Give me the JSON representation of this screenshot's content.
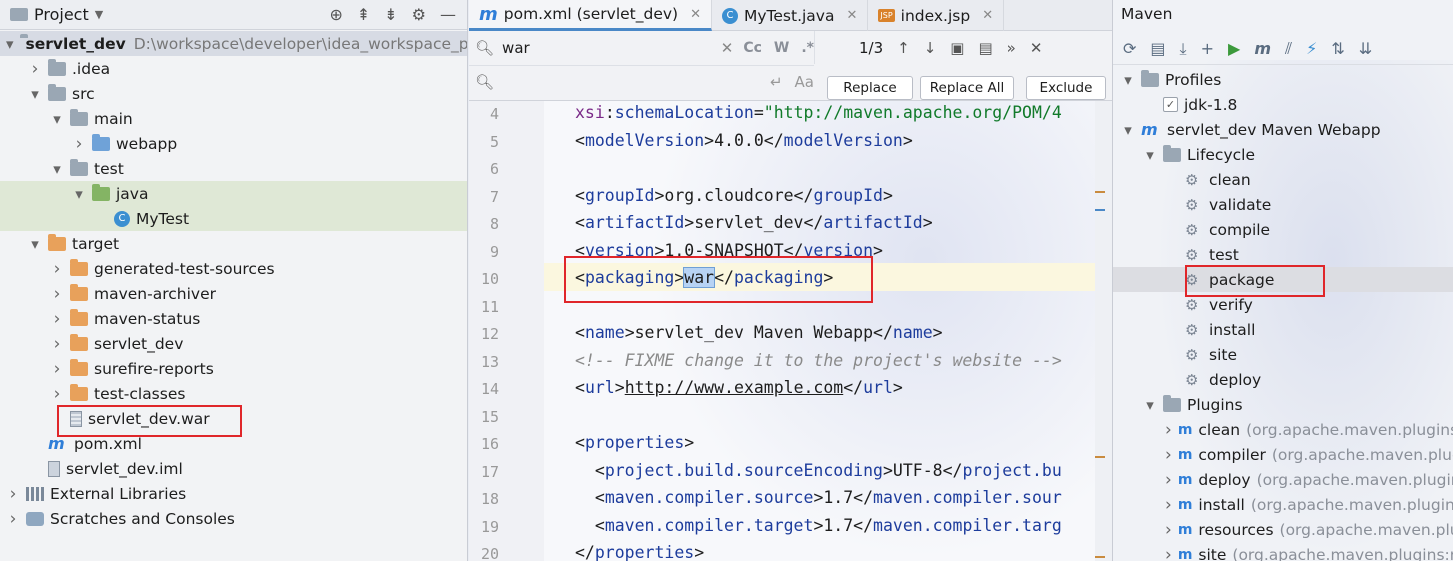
{
  "project": {
    "title": "Project",
    "header_icons": [
      "target-icon",
      "collapse-all-icon",
      "expand-all-icon",
      "gear-icon",
      "minimize-icon"
    ],
    "tree": [
      {
        "label": "servlet_dev",
        "path": "D:\\workspace\\developer\\idea_workspace_p",
        "depth": 0,
        "arrow": "v",
        "icon": "module-folder",
        "bold": true
      },
      {
        "label": ".idea",
        "depth": 1,
        "arrow": ">",
        "icon": "folder"
      },
      {
        "label": "src",
        "depth": 1,
        "arrow": "v",
        "icon": "folder"
      },
      {
        "label": "main",
        "depth": 2,
        "arrow": "v",
        "icon": "folder"
      },
      {
        "label": "webapp",
        "depth": 3,
        "arrow": ">",
        "icon": "folder-blue"
      },
      {
        "label": "test",
        "depth": 2,
        "arrow": "v",
        "icon": "folder"
      },
      {
        "label": "java",
        "depth": 3,
        "arrow": "v",
        "icon": "folder-green"
      },
      {
        "label": "MyTest",
        "depth": 4,
        "arrow": "",
        "icon": "class"
      },
      {
        "label": "target",
        "depth": 1,
        "arrow": "v",
        "icon": "folder-orange"
      },
      {
        "label": "generated-test-sources",
        "depth": 2,
        "arrow": ">",
        "icon": "folder-orange"
      },
      {
        "label": "maven-archiver",
        "depth": 2,
        "arrow": ">",
        "icon": "folder-orange"
      },
      {
        "label": "maven-status",
        "depth": 2,
        "arrow": ">",
        "icon": "folder-orange"
      },
      {
        "label": "servlet_dev",
        "depth": 2,
        "arrow": ">",
        "icon": "folder-orange"
      },
      {
        "label": "surefire-reports",
        "depth": 2,
        "arrow": ">",
        "icon": "folder-orange"
      },
      {
        "label": "test-classes",
        "depth": 2,
        "arrow": ">",
        "icon": "folder-orange"
      },
      {
        "label": "servlet_dev.war",
        "depth": 2,
        "arrow": "",
        "icon": "archive"
      },
      {
        "label": "pom.xml",
        "depth": 1,
        "arrow": "",
        "icon": "maven"
      },
      {
        "label": "servlet_dev.iml",
        "depth": 1,
        "arrow": "",
        "icon": "file"
      },
      {
        "label": "External Libraries",
        "depth": 0,
        "arrow": ">",
        "icon": "libraries"
      },
      {
        "label": "Scratches and Consoles",
        "depth": 0,
        "arrow": ">",
        "icon": "scratches"
      }
    ]
  },
  "editor": {
    "tabs": [
      {
        "label": "pom.xml (servlet_dev)",
        "icon": "m",
        "active": true
      },
      {
        "label": "MyTest.java",
        "icon": "c",
        "active": false
      },
      {
        "label": "index.jsp",
        "icon": "jsp",
        "active": false
      }
    ],
    "search": {
      "query": "war",
      "match_count": "1/3",
      "toggles": [
        "Cc",
        "W",
        ".*"
      ],
      "replace_value": "",
      "buttons": [
        "Replace",
        "Replace All",
        "Exclude"
      ]
    },
    "lines": [
      {
        "n": "4",
        "parts": [
          [
            "ns",
            "xsi"
          ],
          [
            "plain",
            ":"
          ],
          [
            "attr",
            "schemaLocation"
          ],
          [
            "plain",
            "="
          ],
          [
            "val",
            "\"http://maven.apache.org/POM/4"
          ]
        ]
      },
      {
        "n": "5",
        "parts": [
          [
            "plain",
            "<"
          ],
          [
            "tag",
            "modelVersion"
          ],
          [
            "plain",
            ">4.0.0</"
          ],
          [
            "tag",
            "modelVersion"
          ],
          [
            "plain",
            ">"
          ]
        ]
      },
      {
        "n": "6",
        "parts": []
      },
      {
        "n": "7",
        "parts": [
          [
            "plain",
            "<"
          ],
          [
            "tag",
            "groupId"
          ],
          [
            "plain",
            ">org.cloudcore</"
          ],
          [
            "tag",
            "groupId"
          ],
          [
            "plain",
            ">"
          ]
        ]
      },
      {
        "n": "8",
        "parts": [
          [
            "plain",
            "<"
          ],
          [
            "tag",
            "artifactId"
          ],
          [
            "plain",
            ">servlet_dev</"
          ],
          [
            "tag",
            "artifactId"
          ],
          [
            "plain",
            ">"
          ]
        ]
      },
      {
        "n": "9",
        "parts": [
          [
            "plain",
            "<"
          ],
          [
            "tag",
            "version"
          ],
          [
            "plain",
            ">1.0-SNAPSHOT</"
          ],
          [
            "tag",
            "version"
          ],
          [
            "plain",
            ">"
          ]
        ]
      },
      {
        "n": "10",
        "parts": [
          [
            "plain",
            "<"
          ],
          [
            "tag",
            "packaging"
          ],
          [
            "plain",
            ">"
          ],
          [
            "find",
            "war"
          ],
          [
            "plain",
            "</"
          ],
          [
            "tag",
            "packaging"
          ],
          [
            "plain",
            ">"
          ]
        ]
      },
      {
        "n": "11",
        "parts": []
      },
      {
        "n": "12",
        "parts": [
          [
            "plain",
            "<"
          ],
          [
            "tag",
            "name"
          ],
          [
            "plain",
            ">servlet_dev Maven Webapp</"
          ],
          [
            "tag",
            "name"
          ],
          [
            "plain",
            ">"
          ]
        ]
      },
      {
        "n": "13",
        "parts": [
          [
            "cmt",
            "<!-- FIXME change it to the project's website -->"
          ]
        ]
      },
      {
        "n": "14",
        "parts": [
          [
            "plain",
            "<"
          ],
          [
            "tag",
            "url"
          ],
          [
            "plain",
            ">"
          ],
          [
            "link",
            "http://www.example.com"
          ],
          [
            "plain",
            "</"
          ],
          [
            "tag",
            "url"
          ],
          [
            "plain",
            ">"
          ]
        ]
      },
      {
        "n": "15",
        "parts": []
      },
      {
        "n": "16",
        "parts": [
          [
            "plain",
            "<"
          ],
          [
            "tag",
            "properties"
          ],
          [
            "plain",
            ">"
          ]
        ]
      },
      {
        "n": "17",
        "parts": [
          [
            "plain",
            "  <"
          ],
          [
            "tag",
            "project.build.sourceEncoding"
          ],
          [
            "plain",
            ">UTF-8</"
          ],
          [
            "tag",
            "project.bu"
          ]
        ]
      },
      {
        "n": "18",
        "parts": [
          [
            "plain",
            "  <"
          ],
          [
            "tag",
            "maven.compiler.source"
          ],
          [
            "plain",
            ">1.7</"
          ],
          [
            "tag",
            "maven.compiler.sour"
          ]
        ]
      },
      {
        "n": "19",
        "parts": [
          [
            "plain",
            "  <"
          ],
          [
            "tag",
            "maven.compiler.target"
          ],
          [
            "plain",
            ">1.7</"
          ],
          [
            "tag",
            "maven.compiler.targ"
          ]
        ]
      },
      {
        "n": "20",
        "parts": [
          [
            "plain",
            "</"
          ],
          [
            "tag",
            "properties"
          ],
          [
            "plain",
            ">"
          ]
        ]
      }
    ]
  },
  "maven": {
    "title": "Maven",
    "toolbar_icons": [
      "reload-icon",
      "add-folder-icon",
      "download-icon",
      "plus-icon",
      "run-icon",
      "maven-goal-icon",
      "toggle-offline-icon",
      "skip-tests-icon",
      "show-deps-icon",
      "collapse-icon"
    ],
    "tree": [
      {
        "label": "Profiles",
        "depth": 0,
        "arrow": "v",
        "icon": "folder"
      },
      {
        "label": "jdk-1.8",
        "depth": 1,
        "arrow": "",
        "icon": "check"
      },
      {
        "label": "servlet_dev Maven Webapp",
        "depth": 0,
        "arrow": "v",
        "icon": "maven"
      },
      {
        "label": "Lifecycle",
        "depth": 1,
        "arrow": "v",
        "icon": "folder"
      },
      {
        "label": "clean",
        "depth": 2,
        "icon": "gear"
      },
      {
        "label": "validate",
        "depth": 2,
        "icon": "gear"
      },
      {
        "label": "compile",
        "depth": 2,
        "icon": "gear"
      },
      {
        "label": "test",
        "depth": 2,
        "icon": "gear"
      },
      {
        "label": "package",
        "depth": 2,
        "icon": "gear",
        "selected": true
      },
      {
        "label": "verify",
        "depth": 2,
        "icon": "gear"
      },
      {
        "label": "install",
        "depth": 2,
        "icon": "gear"
      },
      {
        "label": "site",
        "depth": 2,
        "icon": "gear"
      },
      {
        "label": "deploy",
        "depth": 2,
        "icon": "gear"
      },
      {
        "label": "Plugins",
        "depth": 1,
        "arrow": "v",
        "icon": "folder"
      },
      {
        "label": "clean",
        "suffix": "(org.apache.maven.plugins:",
        "depth": 2,
        "arrow": ">",
        "icon": "plugin"
      },
      {
        "label": "compiler",
        "suffix": "(org.apache.maven.plugin",
        "depth": 2,
        "arrow": ">",
        "icon": "plugin"
      },
      {
        "label": "deploy",
        "suffix": "(org.apache.maven.plugin",
        "depth": 2,
        "arrow": ">",
        "icon": "plugin"
      },
      {
        "label": "install",
        "suffix": "(org.apache.maven.plugins",
        "depth": 2,
        "arrow": ">",
        "icon": "plugin"
      },
      {
        "label": "resources",
        "suffix": "(org.apache.maven.plu",
        "depth": 2,
        "arrow": ">",
        "icon": "plugin"
      },
      {
        "label": "site",
        "suffix": "(org.apache.maven.plugins:m",
        "depth": 2,
        "arrow": ">",
        "icon": "plugin"
      }
    ]
  },
  "colors": {
    "highlight_box": "#e0262a",
    "find_match": "#b7d3f4",
    "tag": "#1d3c9c",
    "string": "#117a2a",
    "comment": "#8a8a8a"
  }
}
